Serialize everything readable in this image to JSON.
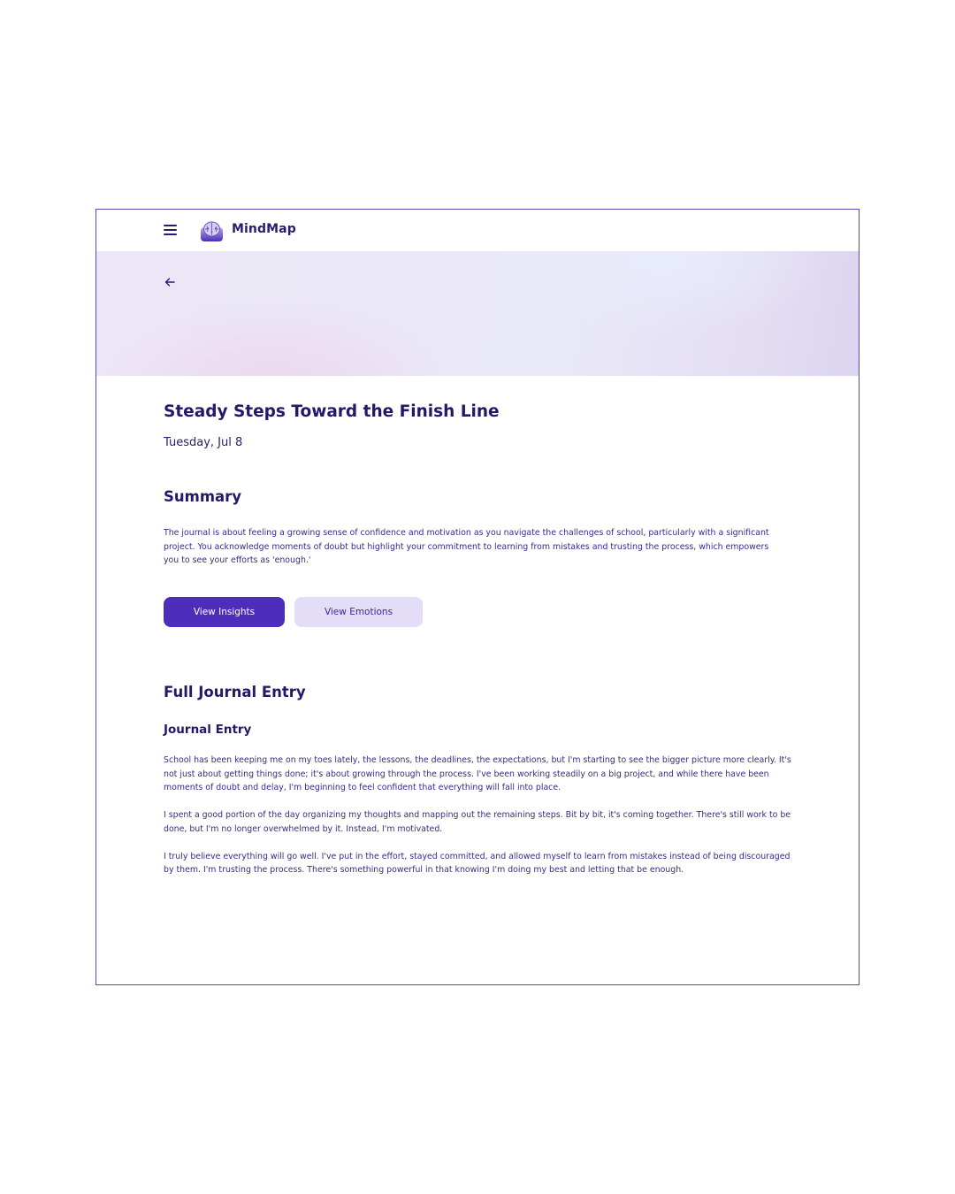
{
  "app": {
    "name": "MindMap"
  },
  "header": {
    "menu_icon": "hamburger-menu-icon",
    "logo_icon": "brain-logo-icon"
  },
  "banner": {
    "back_icon": "arrow-left-icon"
  },
  "entry": {
    "title": "Steady Steps Toward the Finish Line",
    "date": "Tuesday, Jul 8"
  },
  "summary": {
    "heading": "Summary",
    "text": "The journal is about feeling a growing sense of confidence and motivation as you navigate the challenges of school, particularly with a significant project. You acknowledge moments of doubt but highlight your commitment to learning from mistakes and trusting the process, which empowers you to see your efforts as 'enough.'"
  },
  "actions": {
    "insights_label": "View Insights",
    "emotions_label": "View Emotions"
  },
  "full_entry": {
    "heading": "Full Journal Entry",
    "subheading": "Journal Entry",
    "paragraphs": [
      "School has been keeping me on my toes lately, the lessons, the deadlines, the expectations, but I'm starting to see the bigger picture more clearly. It's not just about getting things done; it's about growing through the process. I've been working steadily on a big project, and while there have been moments of doubt and delay, I'm beginning to feel confident that everything will fall into place.",
      "I spent a good portion of the day organizing my thoughts and mapping out the remaining steps. Bit by bit, it's coming together. There's still work to be done, but I'm no longer overwhelmed by it. Instead, I'm motivated.",
      "I truly believe everything will go well. I've put in the effort, stayed committed, and allowed myself to learn from mistakes instead of being discouraged by them. I'm trusting the process. There's something powerful in that knowing I'm doing my best and letting that be enough."
    ]
  },
  "colors": {
    "primary": "#4d2dbb",
    "secondary": "#e4ddf8",
    "text_dark": "#25186a",
    "border": "#5a4ab0"
  }
}
